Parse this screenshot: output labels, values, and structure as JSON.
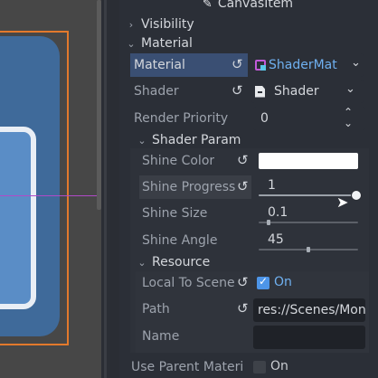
{
  "header": {
    "title": "CanvasItem",
    "icon": "pencil-icon"
  },
  "sections": {
    "visibility": "Visibility",
    "material": "Material"
  },
  "material_row": {
    "label": "Material",
    "value": "ShaderMat"
  },
  "shader_row": {
    "label": "Shader",
    "value": "Shader"
  },
  "render_priority": {
    "label": "Render Priority",
    "value": "0"
  },
  "shader_param": {
    "title": "Shader Param"
  },
  "params": {
    "shine_color": {
      "label": "Shine Color",
      "color": "#ffffff"
    },
    "shine_progress": {
      "label": "Shine Progress",
      "value": "1",
      "fraction": 1.0
    },
    "shine_size": {
      "label": "Shine Size",
      "value": "0.1",
      "fraction": 0.1
    },
    "shine_angle": {
      "label": "Shine Angle",
      "value": "45",
      "fraction": 0.5
    }
  },
  "resource": {
    "title": "Resource",
    "local_to_scene": {
      "label": "Local To Scene",
      "value": "On",
      "checked": true
    },
    "path": {
      "label": "Path",
      "value": "res://Scenes/Mon"
    },
    "name": {
      "label": "Name",
      "value": ""
    }
  },
  "use_parent_material": {
    "label": "Use Parent Materi",
    "value": "On",
    "checked": false
  },
  "colors": {
    "accent": "#4d95e8",
    "selection_outline": "#e3792c",
    "guide": "#b14ac8"
  }
}
